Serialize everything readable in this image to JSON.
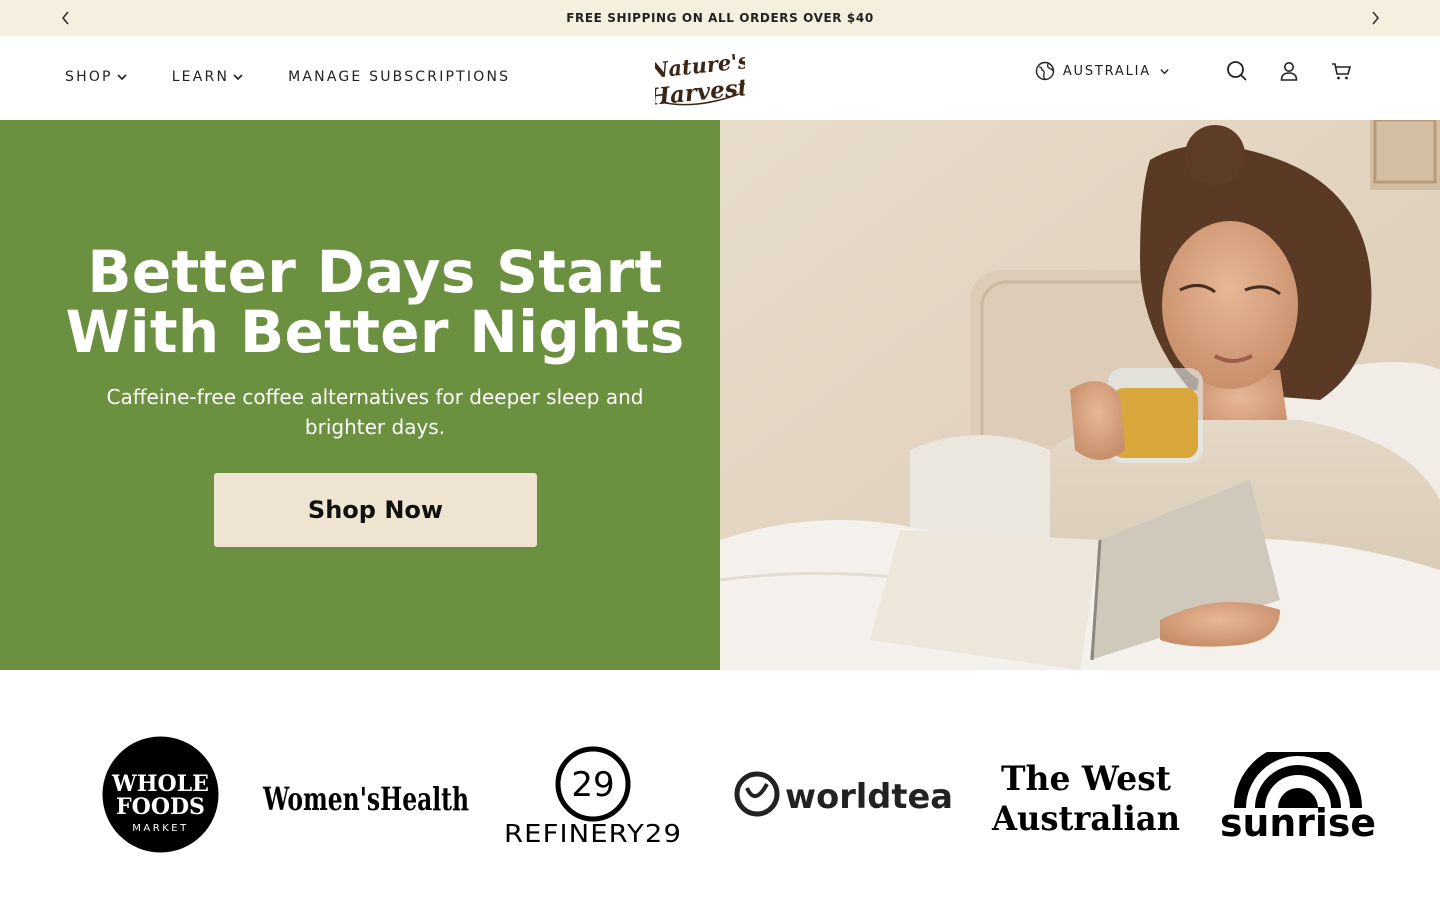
{
  "announcement": {
    "text": "FREE SHIPPING ON ALL ORDERS OVER $40",
    "prev_icon": "chevron-left-icon",
    "next_icon": "chevron-right-icon"
  },
  "header": {
    "nav": [
      {
        "label": "SHOP",
        "has_dropdown": true
      },
      {
        "label": "LEARN",
        "has_dropdown": true
      },
      {
        "label": "MANAGE SUBSCRIPTIONS",
        "has_dropdown": false
      }
    ],
    "logo": {
      "line1": "Nature's",
      "line2": "Harvest"
    },
    "country": "AUSTRALIA",
    "icons": [
      "globe-icon",
      "search-icon",
      "account-icon",
      "cart-icon"
    ]
  },
  "hero": {
    "title_line1": "Better Days Start",
    "title_line2": "With Better Nights",
    "subtitle": "Caffeine-free coffee alternatives for deeper sleep and brighter days.",
    "cta_label": "Shop Now",
    "background_color": "#6b9140",
    "cta_color": "#efe4d2"
  },
  "press": {
    "logos": [
      {
        "name": "Whole Foods Market",
        "line1": "WHOLE",
        "line2": "FOODS",
        "line3": "MARKET"
      },
      {
        "name": "Women's Health",
        "text": "Women'sHealth"
      },
      {
        "name": "Refinery29",
        "text": "REFINERY29",
        "mark": "29"
      },
      {
        "name": "World Tea",
        "text": "worldtea"
      },
      {
        "name": "The West Australian",
        "line1": "The West",
        "line2": "Australian"
      },
      {
        "name": "Sunrise",
        "text": "sunrise"
      }
    ]
  }
}
